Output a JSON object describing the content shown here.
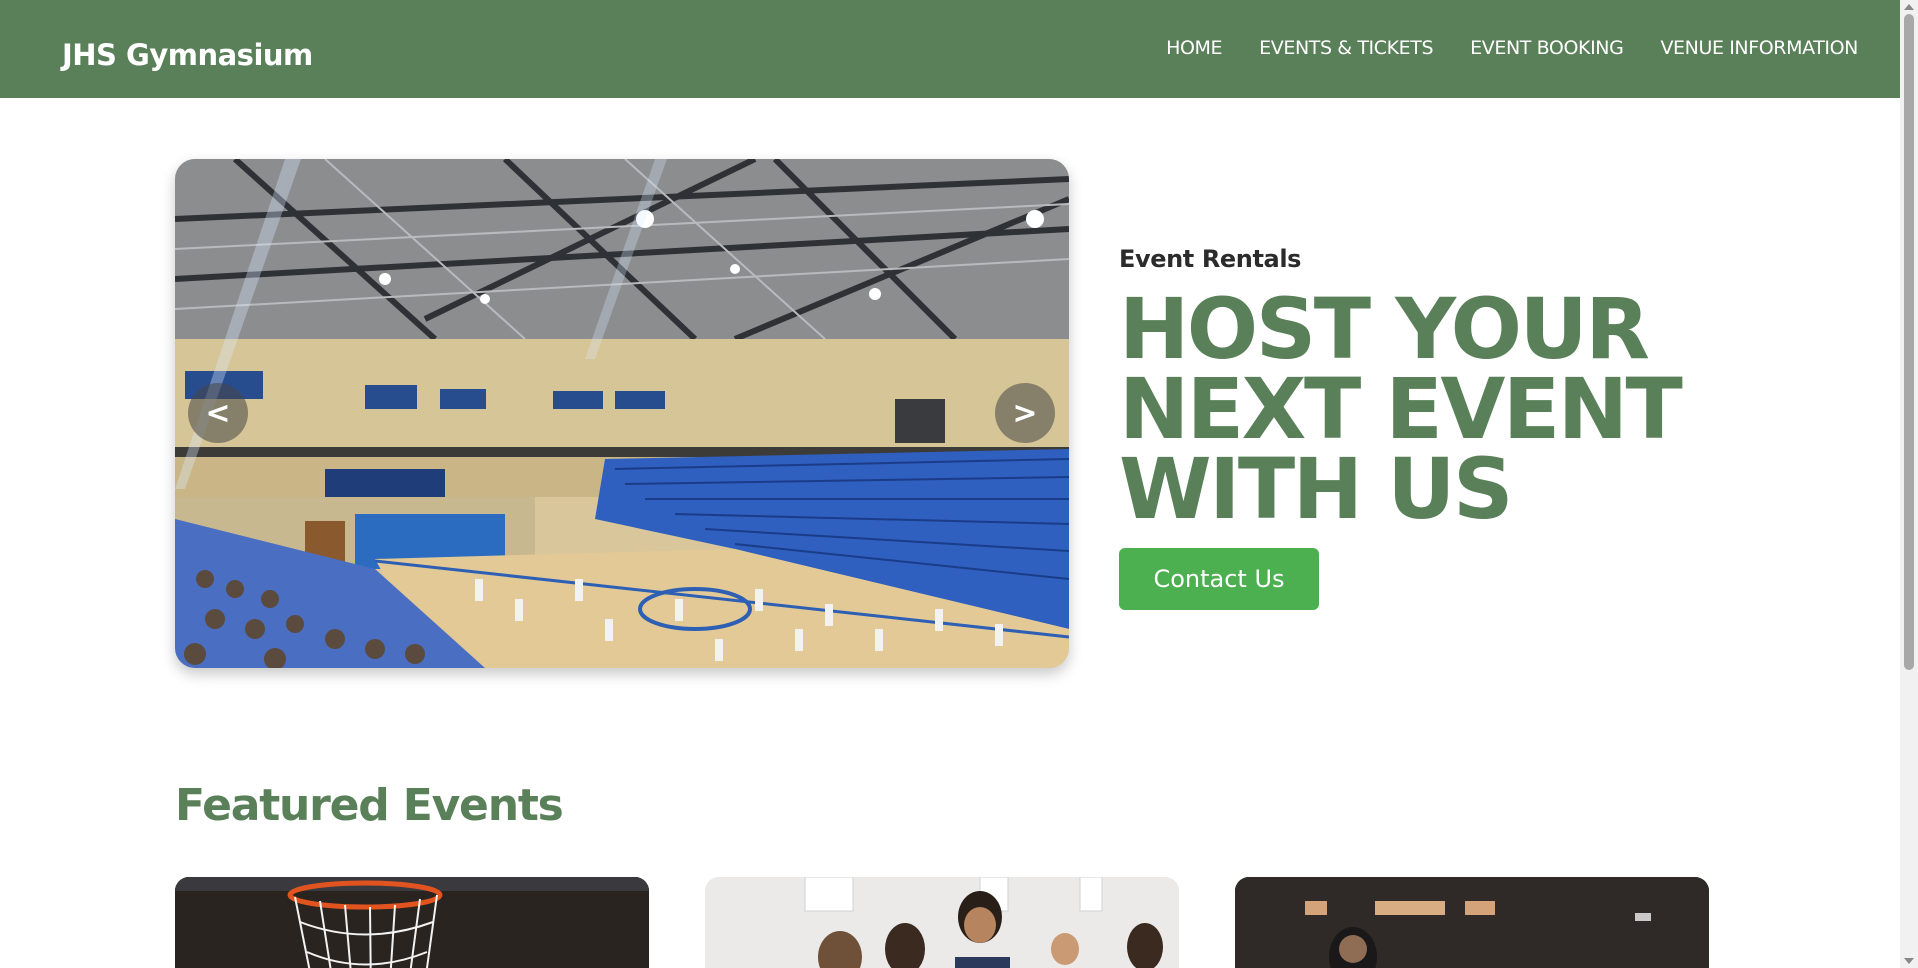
{
  "site": {
    "brand": "JHS Gymnasium"
  },
  "nav": {
    "items": [
      {
        "label": "HOME"
      },
      {
        "label": "EVENTS & TICKETS"
      },
      {
        "label": "EVENT BOOKING"
      },
      {
        "label": "VENUE INFORMATION"
      }
    ]
  },
  "hero": {
    "carousel": {
      "prev_label": "<",
      "next_label": ">",
      "image": "gymnasium-basketball-court-photo"
    },
    "eyebrow": "Event Rentals",
    "headline": "HOST YOUR NEXT EVENT WITH US",
    "cta_label": "Contact Us"
  },
  "featured": {
    "title": "Featured Events",
    "cards": [
      {
        "image": "basketball-hoop-photo"
      },
      {
        "image": "people-at-table-photo"
      },
      {
        "image": "auditorium-stage-photo"
      }
    ]
  },
  "colors": {
    "primary": "#5a8059",
    "accent": "#4cb050",
    "background": "#ffffff"
  }
}
